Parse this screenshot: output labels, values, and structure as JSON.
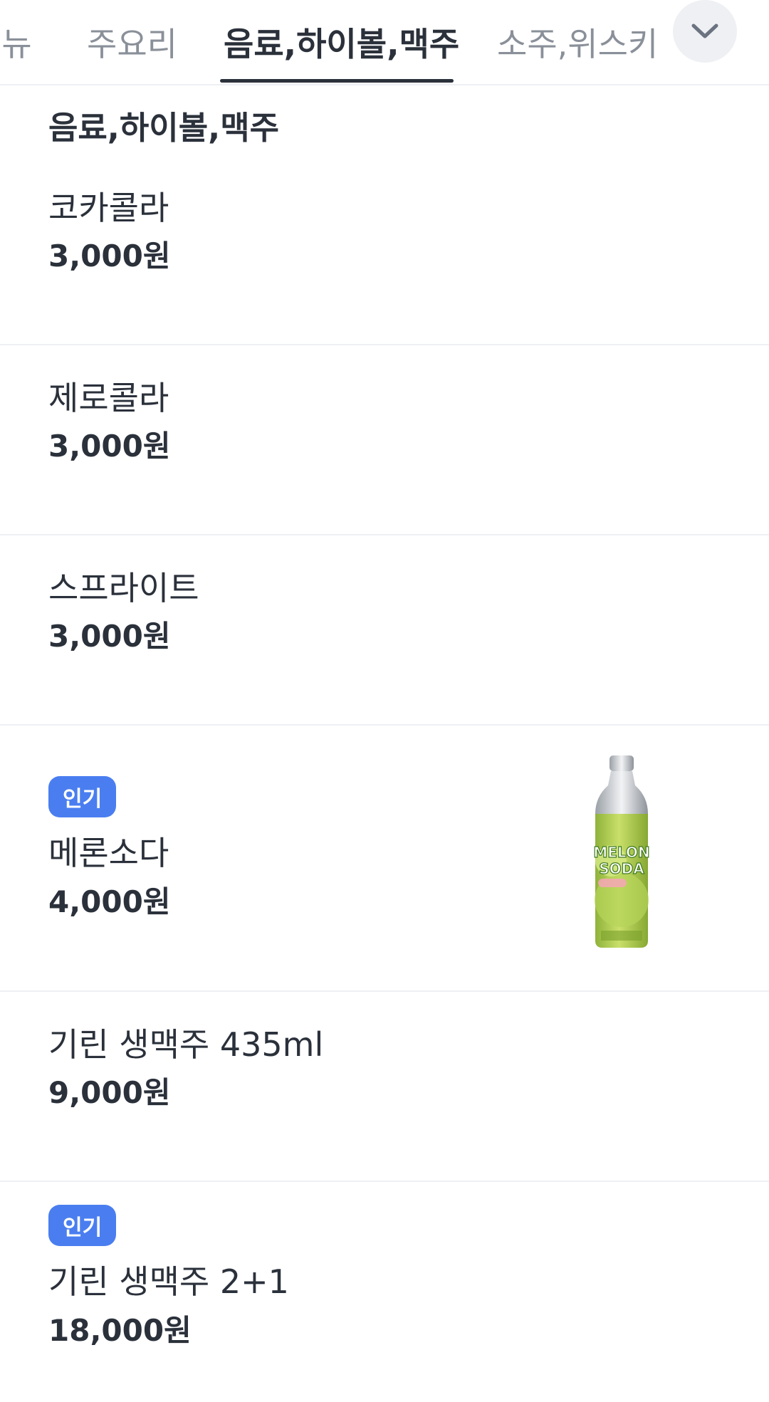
{
  "tabs": [
    {
      "label": "메뉴",
      "active": false
    },
    {
      "label": "주요리",
      "active": false
    },
    {
      "label": "음료,하이볼,맥주",
      "active": true
    },
    {
      "label": "소주,위스키",
      "active": false
    }
  ],
  "section": {
    "title": "음료,하이볼,맥주"
  },
  "items": [
    {
      "name": "코카콜라",
      "price": "3,000원"
    },
    {
      "name": "제로콜라",
      "price": "3,000원"
    },
    {
      "name": "스프라이트",
      "price": "3,000원"
    },
    {
      "badge": "인기",
      "name": "메론소다",
      "price": "4,000원",
      "image_text": [
        "MELON",
        "SODA"
      ]
    },
    {
      "name": "기린 생맥주 435ml",
      "price": "9,000원"
    },
    {
      "badge": "인기",
      "name": "기린 생맥주 2+1",
      "price": "18,000원"
    }
  ],
  "icons": {
    "expand": "chevron-down-icon"
  },
  "colors": {
    "badge": "#4a7ef0",
    "text": "#2b313b",
    "inactive_tab": "#8a9099",
    "divider": "#eef0f3"
  }
}
